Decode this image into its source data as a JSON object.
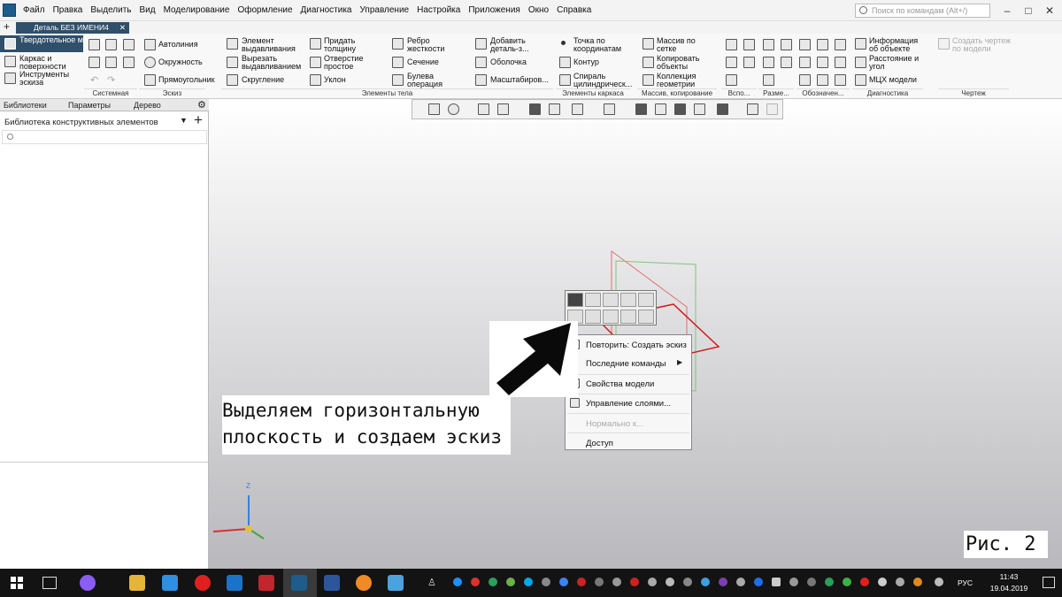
{
  "menu": [
    "Файл",
    "Правка",
    "Выделить",
    "Вид",
    "Моделирование",
    "Оформление",
    "Диагностика",
    "Управление",
    "Настройка",
    "Приложения",
    "Окно",
    "Справка"
  ],
  "search_placeholder": "Поиск по командам (Alt+/)",
  "window_buttons": [
    "–",
    "□",
    "✕"
  ],
  "tab": {
    "plus": "+",
    "title": "Деталь БЕЗ ИМЕНИ4",
    "close": "✕"
  },
  "modes": [
    "Твердотельное моделирование",
    "Каркас и поверхности",
    "Инструменты эскиза"
  ],
  "ribbon": {
    "sketch": [
      "Автолиния",
      "Окружность",
      "Прямоугольник"
    ],
    "solid1": [
      "Элемент выдавливания",
      "Вырезать выдавливанием",
      "Скругление"
    ],
    "solid2": [
      "Придать толщину",
      "Отверстие простое",
      "Уклон"
    ],
    "solid3": [
      "Ребро жесткости",
      "Сечение",
      "Булева операция"
    ],
    "solid4": [
      "Добавить деталь-з...",
      "Оболочка",
      "Масштабиров..."
    ],
    "frame": [
      "Точка по координатам",
      "Контур",
      "Спираль цилиндрическ..."
    ],
    "array": [
      "Массив по сетке",
      "Копировать объекты",
      "Коллекция геометрии"
    ],
    "diag": [
      "Информация об объекте",
      "Расстояние и угол",
      "МЦХ модели"
    ],
    "drawing": "Создать чертеж по модели"
  },
  "groups": [
    "Системная",
    "Эскиз",
    "Элементы тела",
    "Элементы каркаса",
    "Массив, копирование",
    "Вспо...",
    "Разме...",
    "Обозначен...",
    "Диагностика",
    "Чертеж"
  ],
  "left_tabs": [
    "Библиотеки",
    "Параметры",
    "Дерево"
  ],
  "library_title": "Библиотека конструктивных элементов",
  "context_menu": [
    "Повторить: Создать эскиз",
    "Последние команды",
    "Свойства модели",
    "Управление слоями...",
    "Нормально к...",
    "Доступ"
  ],
  "axis_z": "Z",
  "annotation_lines": [
    "Выделяем горизонтальную",
    "плоскость и создаем эскиз"
  ],
  "figure_label": "Рис. 2",
  "taskbar": {
    "lang": "РУС",
    "time": "11:43",
    "date": "19.04.2019"
  }
}
